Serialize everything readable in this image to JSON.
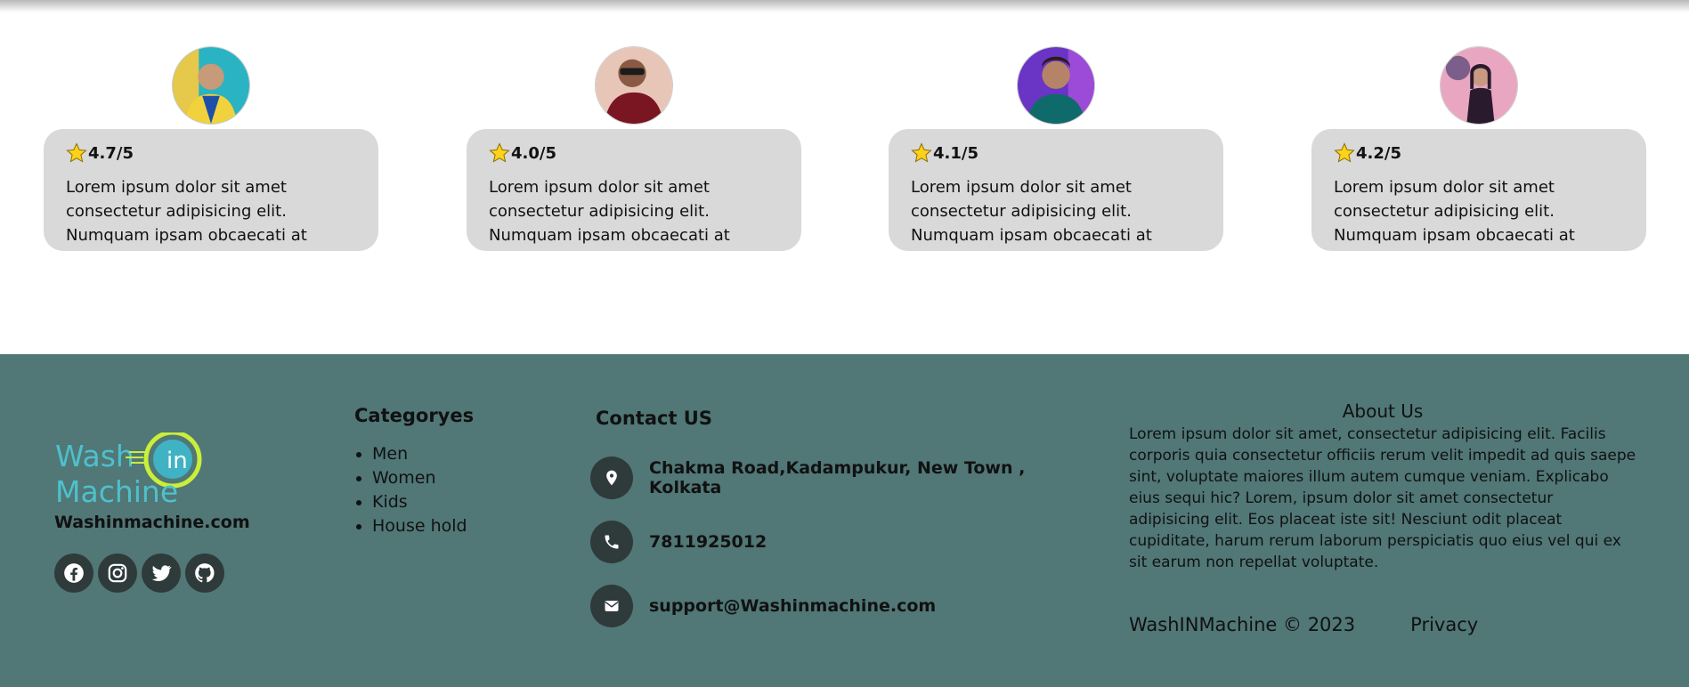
{
  "reviews": [
    {
      "rating": "4.7/5",
      "text": "Lorem ipsum dolor sit amet consectetur adipisicing elit. Numquam ipsam obcaecati at ipsum",
      "avatar_colors": [
        "#2ab3c2",
        "#f2d23c",
        "#1d4fa8"
      ]
    },
    {
      "rating": "4.0/5",
      "text": "Lorem ipsum dolor sit amet consectetur adipisicing elit. Numquam ipsam obcaecati at ipsum",
      "avatar_colors": [
        "#e7c6b8",
        "#7a1622",
        "#2b1a16"
      ]
    },
    {
      "rating": "4.1/5",
      "text": "Lorem ipsum dolor sit amet consectetur adipisicing elit. Numquam ipsam obcaecati at ipsum",
      "avatar_colors": [
        "#6a34c4",
        "#0f6b6b",
        "#2a1c1a"
      ]
    },
    {
      "rating": "4.2/5",
      "text": "Lorem ipsum dolor sit amet consectetur adipisicing elit. Numquam ipsam obcaecati at ipsum",
      "avatar_colors": [
        "#e9a6c0",
        "#2a1a2e",
        "#7b5f8a"
      ]
    }
  ],
  "footer": {
    "background": "#517777",
    "brand": {
      "logo_word_1": "Wash",
      "logo_word_2": "Machine",
      "logo_badge": "in",
      "site_name": "Washinmachine.com"
    },
    "socials": [
      "facebook-icon",
      "instagram-icon",
      "twitter-icon",
      "github-icon"
    ],
    "categories": {
      "title": "Categoryes",
      "items": [
        "Men",
        "Women",
        "Kids",
        "House hold"
      ]
    },
    "contact": {
      "title": "Contact US",
      "address": "Chakma Road,Kadampukur, New Town , Kolkata",
      "phone": "7811925012",
      "email": "support@Washinmachine.com"
    },
    "about": {
      "title": "About Us",
      "text": "Lorem ipsum dolor sit amet, consectetur adipisicing elit. Facilis corporis quia consectetur officiis rerum velit impedit ad quis saepe sint, voluptate maiores illum autem cumque veniam. Explicabo eius sequi hic? Lorem, ipsum dolor sit amet consectetur adipisicing elit. Eos placeat iste sit! Nesciunt odit placeat cupiditate, harum rerum laborum perspiciatis quo eius vel qui ex sit earum non repellat voluptate.",
      "copyright": "WashINMachine © 2023",
      "privacy": "Privacy"
    }
  }
}
